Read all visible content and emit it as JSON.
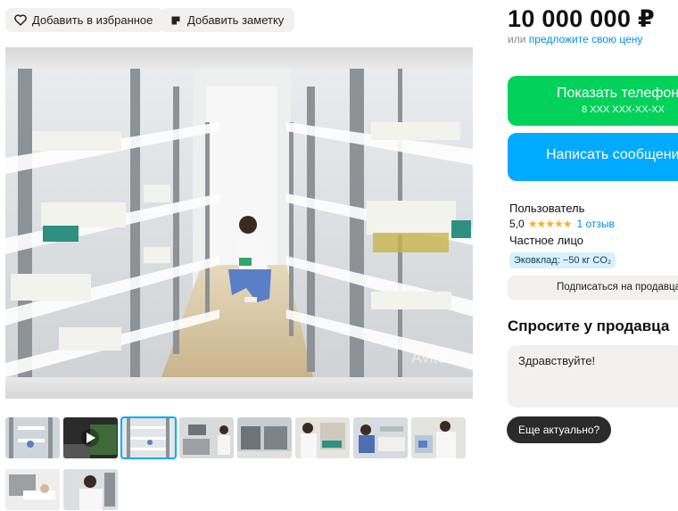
{
  "actions": {
    "favorite_label": "Добавить в избранное",
    "note_label": "Добавить заметку"
  },
  "gallery": {
    "watermark": "Avito",
    "thumbnails": [
      {
        "kind": "photo",
        "active": false
      },
      {
        "kind": "video",
        "active": false
      },
      {
        "kind": "photo",
        "active": true
      },
      {
        "kind": "photo",
        "active": false
      },
      {
        "kind": "photo",
        "active": false
      },
      {
        "kind": "photo",
        "active": false
      },
      {
        "kind": "photo",
        "active": false
      },
      {
        "kind": "photo",
        "active": false
      },
      {
        "kind": "photo",
        "active": false
      },
      {
        "kind": "photo",
        "active": false
      }
    ]
  },
  "price": {
    "value": "10 000 000 ₽",
    "offer_prefix": "или",
    "offer_link": "предложите свою цену"
  },
  "contact": {
    "show_phone_label": "Показать телефон",
    "phone_mask": "8 XXX XXX-XX-XX",
    "write_message_label": "Написать сообщение"
  },
  "seller": {
    "name": "Пользователь",
    "rating_score": "5,0",
    "stars": 5,
    "reviews": "1 отзыв",
    "type": "Частное лицо",
    "eco_badge": "Эковклад: −50 кг CO₂",
    "subscribe_label": "Подписаться на продавца"
  },
  "ask": {
    "title": "Спросите у продавца",
    "message_value": "Здравствуйте!",
    "quick_reply": "Еще актуально?"
  },
  "colors": {
    "green": "#02d15c",
    "blue": "#00aaff",
    "star": "#ffb021",
    "link": "#0091e6"
  }
}
